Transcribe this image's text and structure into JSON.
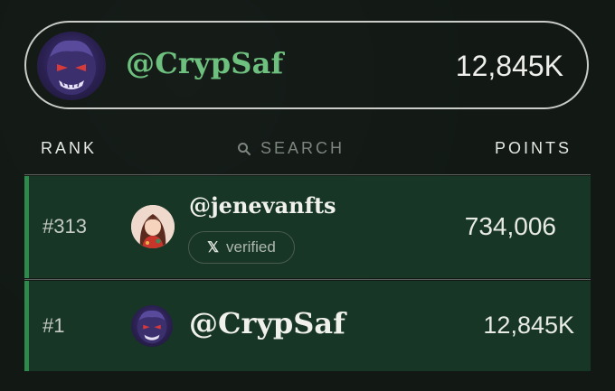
{
  "profile": {
    "handle": "@CrypSaf",
    "points": "12,845K",
    "avatar_icon": "purple-monster-avatar-icon"
  },
  "header": {
    "rank_label": "RANK",
    "search_label": "SEARCH",
    "points_label": "POINTS"
  },
  "rows": [
    {
      "rank": "#313",
      "handle": "@jenevanfts",
      "badge_icon": "x",
      "badge_label": "verified",
      "points": "734,006",
      "avatar_icon": "anime-girl-avatar-icon"
    },
    {
      "rank": "#1",
      "handle": "@CrypSaf",
      "points": "12,845K",
      "avatar_icon": "purple-monster-avatar-icon"
    }
  ],
  "colors": {
    "background": "#121915",
    "accent_green": "#6ec07e",
    "row_background": "#173625",
    "row_accent": "#2e8a4a"
  }
}
